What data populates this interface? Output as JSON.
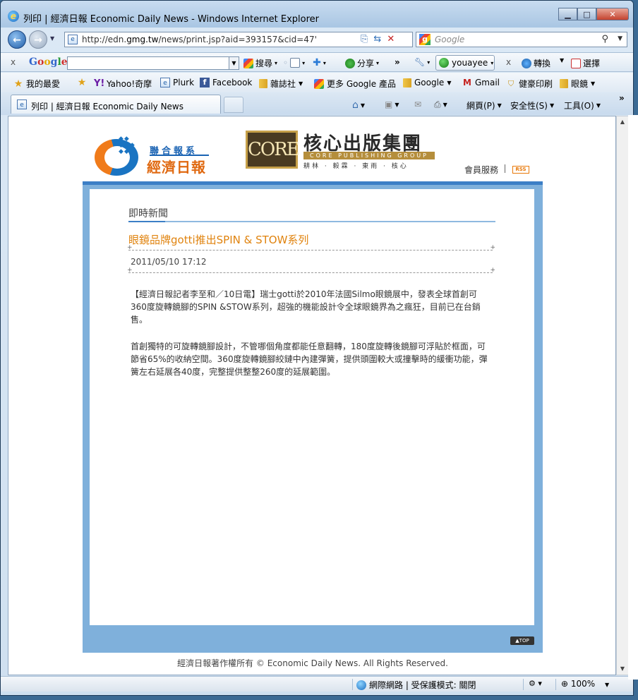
{
  "window": {
    "title": "列印 | 經濟日報 Economic Daily News - Windows Internet Explorer",
    "minimize": "▁",
    "maximize": "□",
    "close": "✕"
  },
  "addressbar": {
    "url_prefix": "http://edn.",
    "url_domain": "gmg.tw",
    "url_suffix": "/news/print.jsp?aid=393157&cid=47'",
    "search_placeholder": "Google"
  },
  "google_toolbar": {
    "close": "x",
    "logo": [
      "G",
      "o",
      "o",
      "g",
      "l",
      "e"
    ],
    "search_label": "搜尋",
    "share_label": "分享",
    "more": "»",
    "user": "youayee",
    "translate_label": "轉換",
    "select_label": "選擇"
  },
  "favorites": {
    "favorites_label": "我的最愛",
    "items": [
      "Yahoo!奇摩",
      "Plurk",
      "Facebook",
      "雜誌社",
      "更多 Google 產品",
      "Google",
      "Gmail",
      "健豪印刷",
      "眼鏡"
    ],
    "more": "»"
  },
  "tabs": {
    "active_label": "列印 | 經濟日報 Economic Daily News"
  },
  "command_bar": {
    "page": "網頁(P)",
    "safety": "安全性(S)",
    "tools": "工具(O)"
  },
  "page": {
    "udn_top": "聯合報系",
    "udn_main": "經濟日報",
    "core_box": "CORE",
    "core_title": "核心出版集團",
    "core_strip": "CORE PUBLISHING GROUP",
    "core_sub": "耕林 · 毅霖 · 東雨 · 核心",
    "member": "會員服務",
    "rss": "RSS",
    "section": "即時新聞",
    "headline": "眼鏡品牌gotti推出SPIN & STOW系列",
    "date": "2011/05/10 17:12",
    "para1": "【經濟日報記者李至和／10日電】瑞士gotti於2010年法國Silmo眼鏡展中，發表全球首創可360度旋轉鏡腳的SPIN &STOW系列，超強的機能設計令全球眼鏡界為之瘋狂，目前已在台銷售。",
    "para2": "首創獨特的可旋轉鏡腳設計，不管哪個角度都能任意翻轉，180度旋轉後鏡腳可浮貼於框面，可節省65%的收納空間。360度旋轉鏡腳絞鏈中內建彈簧，提供頭圍較大或撞擊時的緩衝功能，彈簧左右延展各40度，完整提供整整260度的延展範圍。",
    "top_button": "▲TOP",
    "footer": "經濟日報著作權所有 © Economic Daily News. All Rights Reserved."
  },
  "statusbar": {
    "zone": "網際網路 | 受保護模式: 關閉",
    "zoom": "100%"
  }
}
